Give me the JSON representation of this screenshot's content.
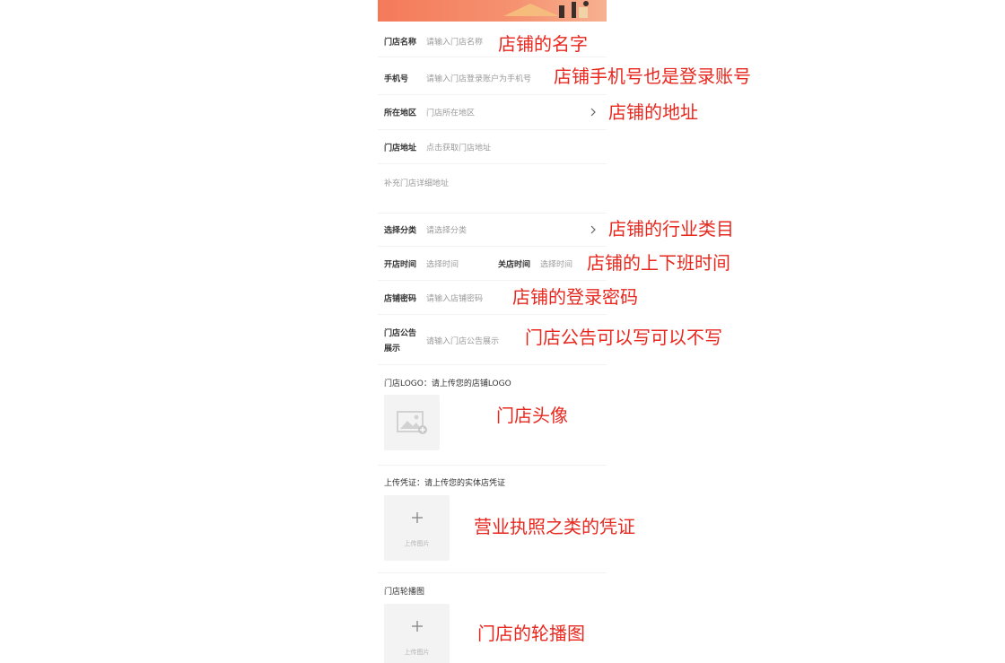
{
  "form": {
    "store_name": {
      "label": "门店名称",
      "placeholder": "请输入门店名称"
    },
    "phone": {
      "label": "手机号",
      "placeholder": "请输入门店登录账户为手机号"
    },
    "region": {
      "label": "所在地区",
      "placeholder": "门店所在地区"
    },
    "address": {
      "label": "门店地址",
      "placeholder": "点击获取门店地址"
    },
    "address_detail": {
      "placeholder": "补充门店详细地址"
    },
    "category": {
      "label": "选择分类",
      "placeholder": "请选择分类"
    },
    "hours": {
      "open_label": "开店时间",
      "open_placeholder": "选择时间",
      "close_label": "关店时间",
      "close_placeholder": "选择时间"
    },
    "password": {
      "label": "店铺密码",
      "placeholder": "请输入店铺密码"
    },
    "notice": {
      "label_line1": "门店公告",
      "label_line2": "展示",
      "placeholder": "请输入门店公告展示"
    },
    "logo": {
      "label": "门店LOGO：请上传您的店铺LOGO"
    },
    "credential": {
      "label": "上传凭证：请上传您的实体店凭证",
      "upload_text": "上传图片"
    },
    "carousel": {
      "label": "门店轮播图",
      "upload_text": "上传图片"
    }
  },
  "annotations": {
    "store_name": "店铺的名字",
    "phone": "店铺手机号也是登录账号",
    "address": "店铺的地址",
    "category": "店铺的行业类目",
    "hours": "店铺的上下班时间",
    "password": "店铺的登录密码",
    "notice": "门店公告可以写可以不写",
    "logo": "门店头像",
    "credential": "营业执照之类的凭证",
    "carousel": "门店的轮播图"
  },
  "icons": {
    "chevron": "chevron-right-icon",
    "image_placeholder": "image-placeholder-icon",
    "plus": "plus-icon"
  },
  "colors": {
    "annotation": "#e8281f",
    "banner_start": "#f47a5a",
    "banner_end": "#f7b191",
    "placeholder_text": "#9a9a9a",
    "upload_bg": "#f3f3f3"
  }
}
